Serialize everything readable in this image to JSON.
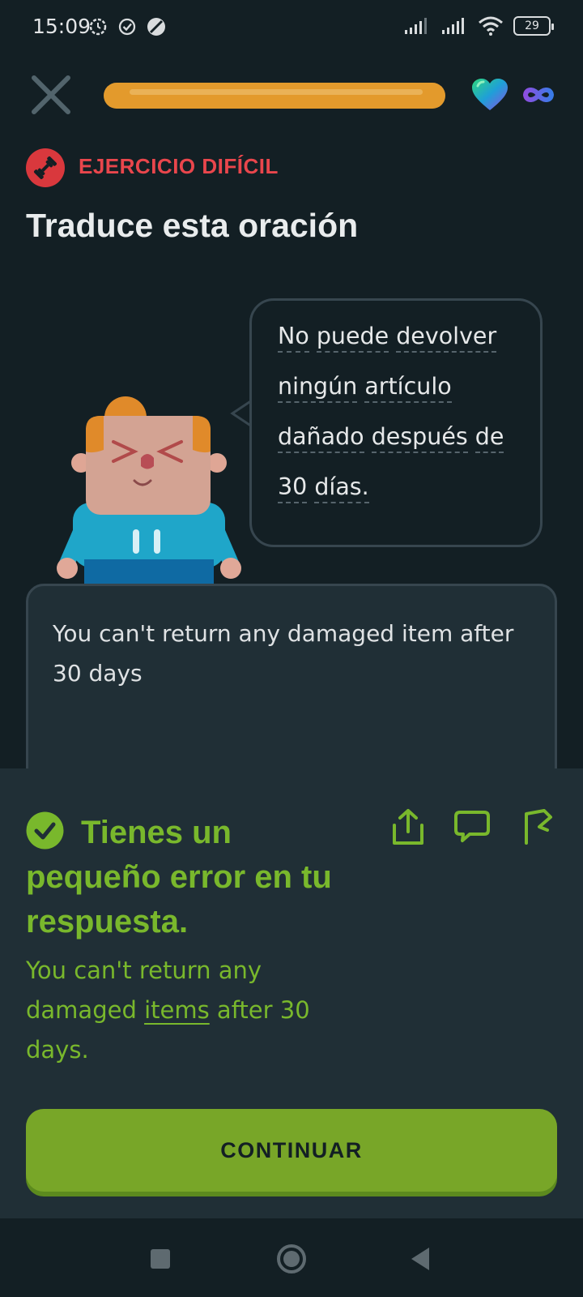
{
  "status_bar": {
    "time": "15:09",
    "battery": "29",
    "left_icons": [
      "settings-sync-icon",
      "check-circle-icon",
      "no-disturb-icon"
    ],
    "right_icons": [
      "signal-1-icon",
      "signal-2-icon",
      "wifi-icon",
      "battery-icon"
    ]
  },
  "top_bar": {
    "progress": 1.0,
    "progress_color": "#e39a2c",
    "hearts_icon": "heart-gradient-icon",
    "hearts_value": "infinity-icon"
  },
  "header": {
    "badge_label": "EJERCICIO DIFÍCIL",
    "title": "Traduce esta oración"
  },
  "prompt": {
    "lines": [
      [
        "No",
        "puede",
        "devolver"
      ],
      [
        "ningún",
        "artículo"
      ],
      [
        "dañado",
        "después",
        "de"
      ],
      [
        "30",
        "días."
      ]
    ]
  },
  "answer": {
    "text": "You can't return any damaged item after 30 days"
  },
  "feedback": {
    "title": "Tienes un pequeño error en tu respuesta.",
    "correction_before": "You can't return any damaged ",
    "correction_highlight": "items",
    "correction_after": " after 30 days.",
    "accent_color": "#79b82c",
    "actions": [
      "share-icon",
      "comment-icon",
      "report-flag-icon"
    ]
  },
  "continue_label": "CONTINUAR",
  "nav": {
    "items": [
      "recents-button",
      "home-button",
      "back-button"
    ]
  }
}
